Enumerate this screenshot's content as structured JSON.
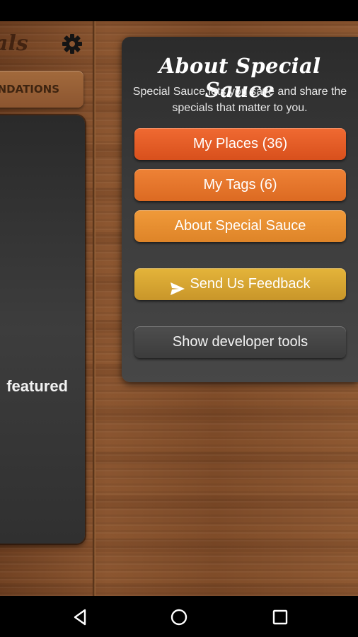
{
  "left_panel": {
    "title_fragment": "als",
    "recommendations_fragment": "NDATIONS",
    "featured_fragment": "featured"
  },
  "about": {
    "title": "About Special Sauce",
    "description": "Special Sauce lets you save and share the specials that matter to you.",
    "buttons": {
      "places": "My Places (36)",
      "tags": "My Tags (6)",
      "about": "About Special Sauce",
      "feedback": "Send Us Feedback",
      "dev": "Show developer tools"
    }
  },
  "icons": {
    "settings": "gear-icon",
    "send": "send-icon",
    "back": "back-icon",
    "home": "home-icon",
    "recents": "recents-icon"
  },
  "colors": {
    "places": "#e55a25",
    "tags": "#e5762c",
    "about": "#e88f32",
    "feedback": "#d7a533",
    "dev": "#444444"
  }
}
